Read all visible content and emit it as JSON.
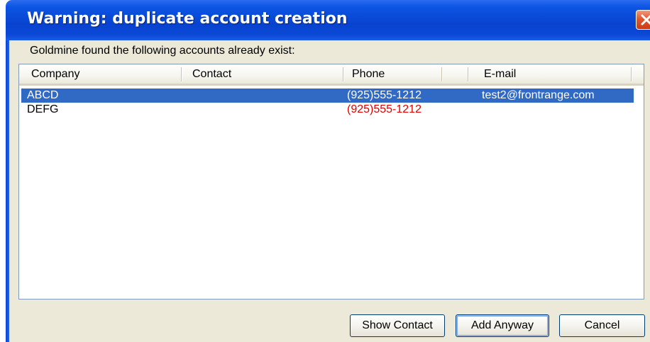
{
  "window": {
    "title": "Warning: duplicate account creation"
  },
  "message": "Goldmine found the following accounts already exist:",
  "columns": [
    "Company",
    "Contact",
    "Phone",
    "E-mail"
  ],
  "rows": [
    {
      "company": "ABCD",
      "contact": "",
      "phone": "(925)555-1212",
      "email": "test2@frontrange.com",
      "selected": true
    },
    {
      "company": "DEFG",
      "contact": "",
      "phone": "(925)555-1212",
      "email": "",
      "selected": false,
      "phone_color": "#e00000"
    }
  ],
  "buttons": {
    "show_contact": "Show Contact",
    "add_anyway": "Add Anyway",
    "cancel": "Cancel"
  },
  "colors": {
    "titlebar": "#0843cf",
    "selection": "#316ac5",
    "dialog_face": "#ece9d8",
    "duplicate_phone": "#e00000",
    "close_button": "#e0582f"
  },
  "icons": {
    "close": "close-icon"
  }
}
